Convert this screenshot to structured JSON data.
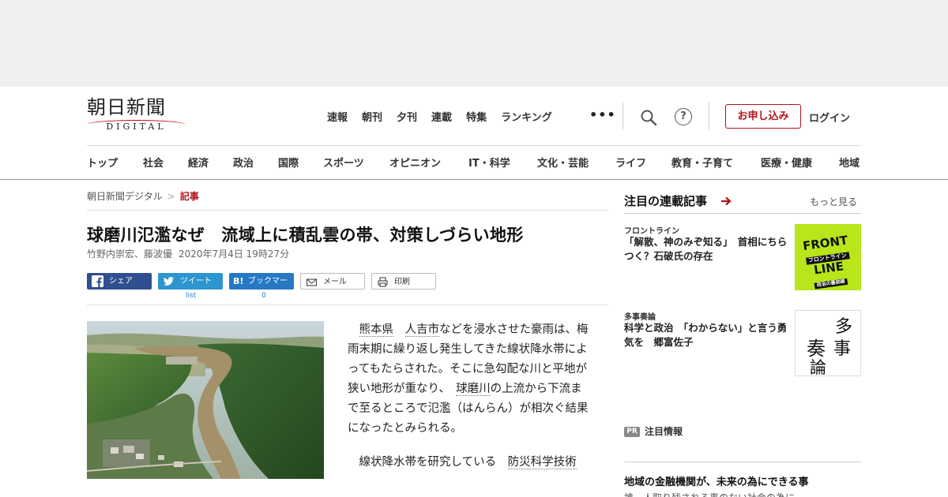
{
  "header": {
    "logo_main": "朝日新聞",
    "logo_sub": "DIGITAL",
    "topnav": [
      "速報",
      "朝刊",
      "夕刊",
      "連載",
      "特集",
      "ランキング"
    ],
    "more_label": "•••",
    "apply_label": "お申し込み",
    "login_label": "ログイン",
    "help_glyph": "?"
  },
  "catnav": [
    "トップ",
    "社会",
    "経済",
    "政治",
    "国際",
    "スポーツ",
    "オピニオン",
    "IT・科学",
    "文化・芸能",
    "ライフ",
    "教育・子育て",
    "医療・健康",
    "地域"
  ],
  "breadcrumb": {
    "home": "朝日新聞デジタル",
    "separator": ">",
    "current": "記事"
  },
  "article": {
    "headline": "球磨川氾濫なぜ　流域上に積乱雲の帯、対策しづらい地形",
    "authors": "竹野内崇宏、藤波優",
    "date": "2020年7月4日 19時27分",
    "body_p1_link1": "熊本県",
    "body_p1_link2": "人吉市",
    "body_p1_a": "などを浸水させた豪雨は、梅雨末期に繰り返し発生してきた線状降水帯によってもたらされた。そこに急勾配な川と平地が狭い地形が重なり、",
    "body_p1_link3": "球磨川",
    "body_p1_b": "の上流から下流まで至るところで氾濫（はんらん）が相次ぐ結果になったとみられる。",
    "body_p2_a": "線状降水帯を研究している",
    "body_p2_link": "防災科学技術"
  },
  "share": {
    "facebook": "シェア",
    "twitter": "ツイート",
    "hatena": "ブックマーク",
    "hatena_icon": "B!",
    "mail": "メール",
    "print": "印刷",
    "twitter_count": "list",
    "hatena_count": "0"
  },
  "sidebar": {
    "title": "注目の連載記事",
    "more": "もっと見る",
    "cards": [
      {
        "kicker": "フロントライン",
        "title": "「解散、神のみぞ知る」　首相にちらつく？石破氏の存在",
        "thumb_line1": "FRONT",
        "thumb_line2": "LINE",
        "thumb_sub": "フロントライン",
        "thumb_small": "政治の最前線"
      },
      {
        "kicker": "多事奏論",
        "title": "科学と政治　「わからない」と言う勇気を　郷富佐子",
        "thumb_chars": [
          "多",
          "事",
          "奏",
          "論"
        ]
      }
    ],
    "pr_badge": "PR",
    "pr_label": "注目情報",
    "pr_title": "地域の金融機関が、未来の為にできる事",
    "pr_sub": "誰一人取り残される事のない社会の為に"
  },
  "colors": {
    "brand_red": "#b5121b",
    "facebook": "#2f4f8f",
    "twitter": "#2d95d0",
    "hatena": "#2678c4",
    "frontline_bg": "#b8e61a"
  }
}
